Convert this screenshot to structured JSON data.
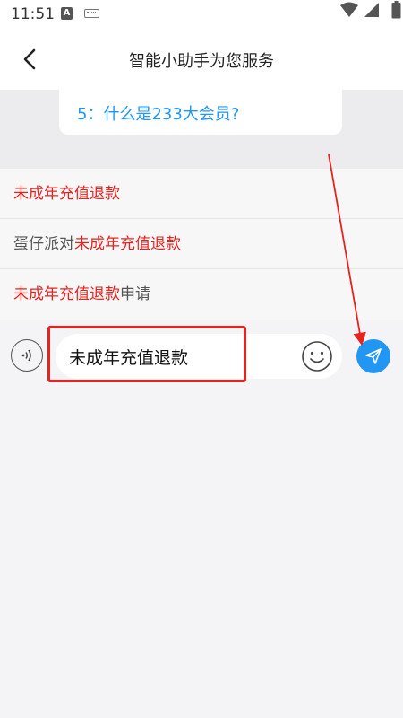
{
  "status_bar": {
    "time": "11:51",
    "notification_icons": [
      "a-app-icon",
      "keyboard-icon"
    ],
    "system_icons": [
      "wifi-icon",
      "signal-icon",
      "battery-icon"
    ]
  },
  "header": {
    "title": "智能小助手为您服务",
    "back_icon": "chevron-left-icon"
  },
  "chat": {
    "faq_item": "5：什么是233大会员?"
  },
  "suggestions": [
    {
      "before": "",
      "highlight": "未成年充值退款",
      "after": ""
    },
    {
      "before": "蛋仔派对",
      "highlight": "未成年充值退款",
      "after": ""
    },
    {
      "before": "",
      "highlight": "未成年充值退款",
      "after": "申请"
    }
  ],
  "input_bar": {
    "value": "未成年充值退款",
    "voice_icon": "voice-icon",
    "emoji_icon": "smiley-icon",
    "send_icon": "paper-plane-icon"
  },
  "colors": {
    "accent": "#2196f3",
    "highlight_text": "#e8231e",
    "annotation": "#e8231e",
    "background": "#f4f4f6"
  }
}
